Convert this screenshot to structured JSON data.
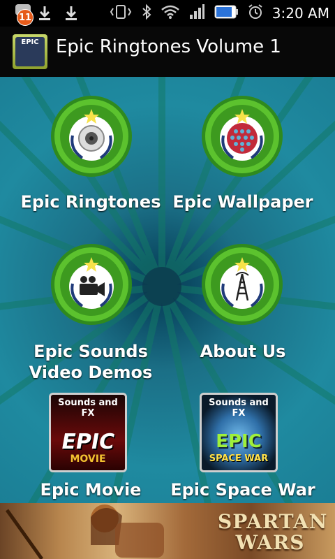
{
  "status_bar": {
    "notification_count": "11",
    "time": "3:20 AM",
    "icons": [
      "notification-icon",
      "download-icon",
      "download-icon",
      "vibrate-icon",
      "bluetooth-icon",
      "wifi-icon",
      "signal-icon",
      "battery-icon",
      "alarm-icon"
    ]
  },
  "app_bar": {
    "title": "Epic Ringtones Volume 1",
    "icon_text": "EPIC"
  },
  "menu": {
    "items": [
      {
        "label": "Epic Ringtones",
        "icon": "speaker-icon"
      },
      {
        "label": "Epic Wallpaper",
        "icon": "wallpaper-icon"
      },
      {
        "label": "Epic Sounds\nVideo Demos",
        "icon": "video-camera-icon"
      },
      {
        "label": "About Us",
        "icon": "tower-icon"
      },
      {
        "label": "Epic Movie",
        "poster_top": "Sounds and FX",
        "poster_title": "EPIC",
        "poster_sub": "MOVIE"
      },
      {
        "label": "Epic Space War",
        "poster_top": "Sounds and FX",
        "poster_title": "EPIC",
        "poster_sub": "SPACE WAR"
      }
    ]
  },
  "ad_banner": {
    "title_line1": "SPARTAN",
    "title_line2": "WARS"
  },
  "colors": {
    "background": "#1a7c93",
    "medal_green": "#4fae2a",
    "title_bar": "#080808"
  }
}
